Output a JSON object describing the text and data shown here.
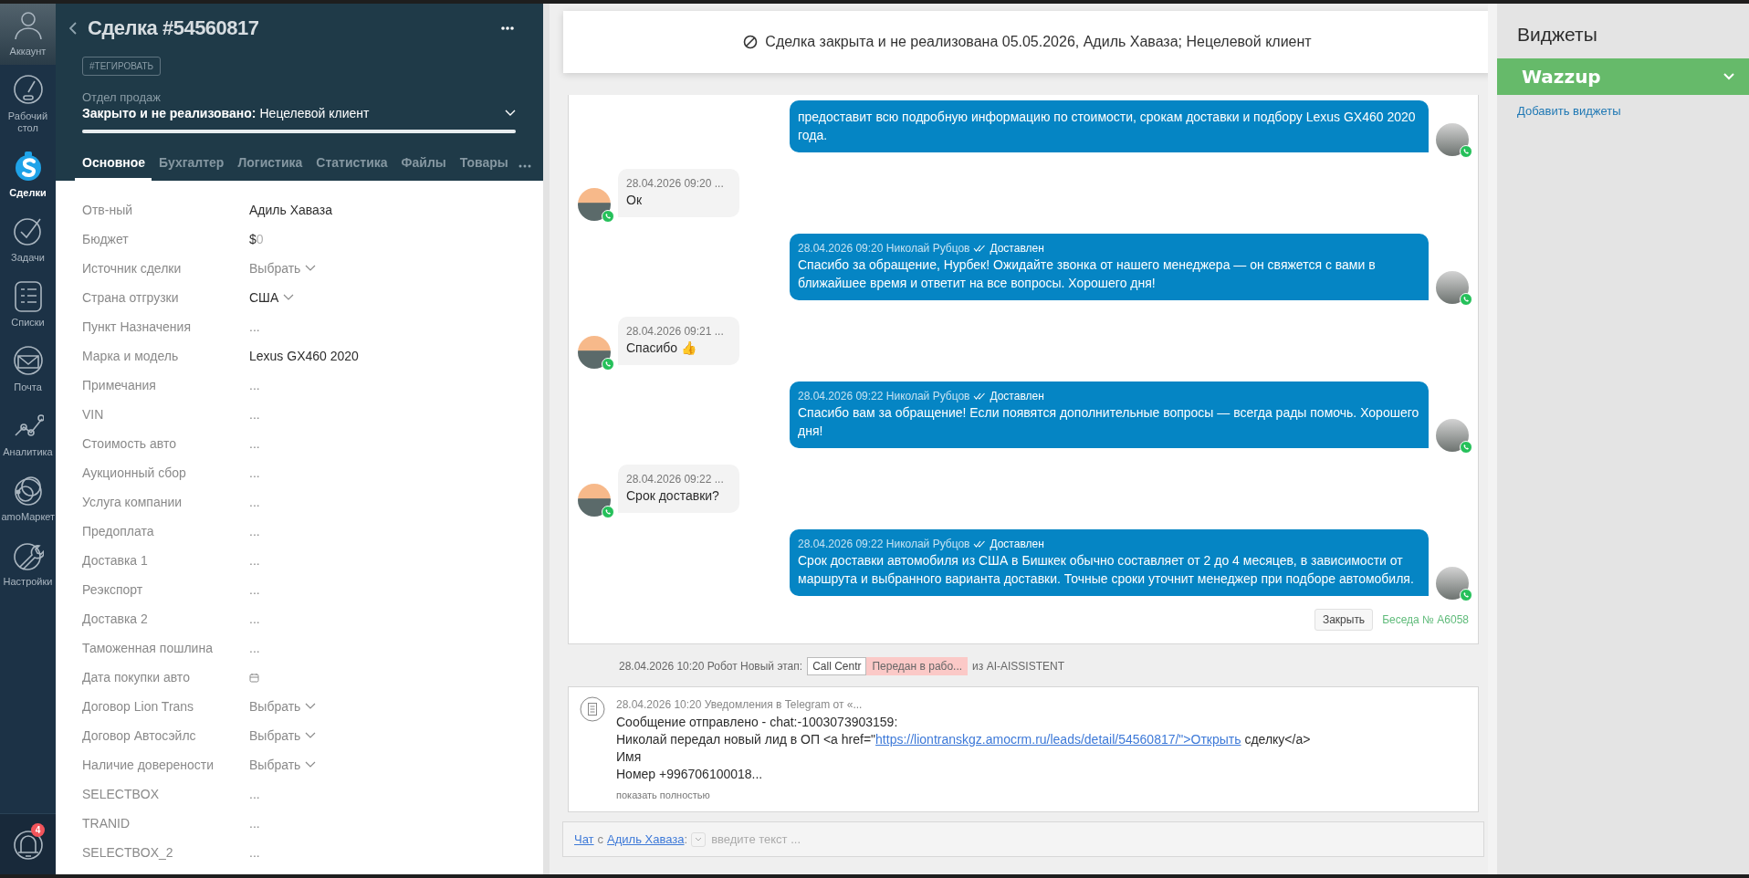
{
  "nav": {
    "items": [
      {
        "kind": "account",
        "label": "Аккаунт",
        "selected": false
      },
      {
        "kind": "dashboard",
        "label": "Рабочий стол",
        "selected": false
      },
      {
        "kind": "deals",
        "label": "Сделки",
        "selected": true
      },
      {
        "kind": "tasks",
        "label": "Задачи",
        "selected": false
      },
      {
        "kind": "lists",
        "label": "Списки",
        "selected": false
      },
      {
        "kind": "mail",
        "label": "Почта",
        "selected": false
      },
      {
        "kind": "analytics",
        "label": "Аналитика",
        "selected": false
      },
      {
        "kind": "market",
        "label": "amoМаркет",
        "selected": false
      },
      {
        "kind": "settings",
        "label": "Настройки",
        "selected": false
      }
    ],
    "notifications": {
      "badge": "4"
    }
  },
  "deal": {
    "title": "Сделка #54560817",
    "tag_button": "#ТЕГИРОВАТЬ",
    "pipeline": "Отдел продаж",
    "status_label": "Закрыто и не реализовано:",
    "status_value": "Нецелевой клиент",
    "status_bar": {
      "level": 1
    },
    "tabs": [
      {
        "label": "Основное",
        "selected": true
      },
      {
        "label": "Бухгалтер",
        "selected": false
      },
      {
        "label": "Логистика",
        "selected": false
      },
      {
        "label": "Статистика",
        "selected": false
      },
      {
        "label": "Файлы",
        "selected": false
      },
      {
        "label": "Товары",
        "selected": false
      }
    ],
    "fields": [
      {
        "label": "Отв-ный",
        "kind": "text",
        "value": "Адиль Хаваза"
      },
      {
        "label": "Бюджет",
        "kind": "money",
        "currency": "$",
        "value": "0"
      },
      {
        "label": "Источник сделки",
        "kind": "select",
        "placeholder": "Выбрать"
      },
      {
        "label": "Страна отгрузки",
        "kind": "select_filled",
        "value": "США"
      },
      {
        "label": "Пункт Назначения",
        "kind": "empty",
        "value": "..."
      },
      {
        "label": "Марка и модель",
        "kind": "text",
        "value": "Lexus GX460 2020"
      },
      {
        "label": "Примечания",
        "kind": "empty",
        "value": "..."
      },
      {
        "label": "VIN",
        "kind": "empty",
        "value": "..."
      },
      {
        "label": "Стоимость авто",
        "kind": "empty",
        "value": "..."
      },
      {
        "label": "Аукционный сбор",
        "kind": "empty",
        "value": "..."
      },
      {
        "label": "Услуга компании",
        "kind": "empty",
        "value": "..."
      },
      {
        "label": "Предоплата",
        "kind": "empty",
        "value": "..."
      },
      {
        "label": "Доставка 1",
        "kind": "empty",
        "value": "..."
      },
      {
        "label": "Реэкспорт",
        "kind": "empty",
        "value": "..."
      },
      {
        "label": "Доставка 2",
        "kind": "empty",
        "value": "..."
      },
      {
        "label": "Таможенная пошлина",
        "kind": "empty",
        "value": "..."
      },
      {
        "label": "Дата покупки авто",
        "kind": "date"
      },
      {
        "label": "Договор Lion Trans",
        "kind": "select",
        "placeholder": "Выбрать"
      },
      {
        "label": "Договор Автосэйлс",
        "kind": "select",
        "placeholder": "Выбрать"
      },
      {
        "label": "Наличие доверености",
        "kind": "select",
        "placeholder": "Выбрать"
      },
      {
        "label": "SELECTBOX",
        "kind": "empty",
        "value": "..."
      },
      {
        "label": "TRANID",
        "kind": "empty",
        "value": "..."
      },
      {
        "label": "SELECTBOX_2",
        "kind": "empty",
        "value": "..."
      }
    ]
  },
  "banner": {
    "text": "Сделка закрыта и не реализована 05.05.2026, Адиль Хаваза; Нецелевой клиент"
  },
  "chat": {
    "messages": [
      {
        "kind": "outgoing",
        "text": "предоставит всю подробную информацию по стоимости, срокам доставки и подбору Lexus GX460 2020 года."
      },
      {
        "kind": "incoming",
        "meta": "28.04.2026 09:20 ...",
        "text": "Ок"
      },
      {
        "kind": "outgoing",
        "meta": "28.04.2026 09:20 Николай Рубцов",
        "status": "Доставлен",
        "text": "Спасибо за обращение, Нурбек! Ожидайте звонка от нашего менеджера — он свяжется с вами в ближайшее время и ответит на все вопросы. Хорошего дня!"
      },
      {
        "kind": "incoming",
        "meta": "28.04.2026 09:21 ...",
        "text": "Спасибо 👍"
      },
      {
        "kind": "outgoing",
        "meta": "28.04.2026 09:22 Николай Рубцов",
        "status": "Доставлен",
        "text": "Спасибо вам за обращение! Если появятся дополнительные вопросы — всегда рады помочь. Хорошего дня!"
      },
      {
        "kind": "incoming",
        "meta": "28.04.2026 09:22 ...",
        "text": "Срок доставки?"
      },
      {
        "kind": "outgoing",
        "meta": "28.04.2026 09:22 Николай Рубцов",
        "status": "Доставлен",
        "text": "Срок доставки автомобиля из США в Бишкек обычно составляет от 2 до 4 месяцев, в зависимости от маршрута и выбранного варианта доставки. Точные сроки уточнит менеджер при подборе автомобиля."
      }
    ],
    "close_button": "Закрыть",
    "conversation_link": "Беседа № A6058"
  },
  "event": {
    "text": "28.04.2026 10:20 Робот Новый этап:",
    "chips": [
      {
        "kind": "outlined",
        "label": "Call Centr"
      },
      {
        "kind": "highlight",
        "label": "Передан в рабо..."
      }
    ],
    "suffix": "из AI-AISSISTENT"
  },
  "note": {
    "meta": "28.04.2026 10:20 Уведомления в Telegram от «...",
    "lines": [
      {
        "text": "Сообщение отправлено - chat:-1003073903159:"
      },
      {
        "text": "Николай передал новый лид в ОП <a href=\"",
        "link": "https://liontranskgz.amocrm.ru/leads/detail/54560817/\">Открыть",
        "after": " сделку</a>"
      },
      {
        "text": "Имя"
      },
      {
        "text": "Номер +996706100018..."
      }
    ],
    "expand_link": "показать полностью"
  },
  "composer": {
    "chat_link": "Чат",
    "connector": "с",
    "contact_link": "Адиль Хаваза",
    "colon": ":",
    "placeholder": "введите текст ..."
  },
  "widgets": {
    "title": "Виджеты",
    "items": [
      {
        "name": "Wazzup"
      }
    ],
    "add_link": "Добавить виджеты"
  }
}
